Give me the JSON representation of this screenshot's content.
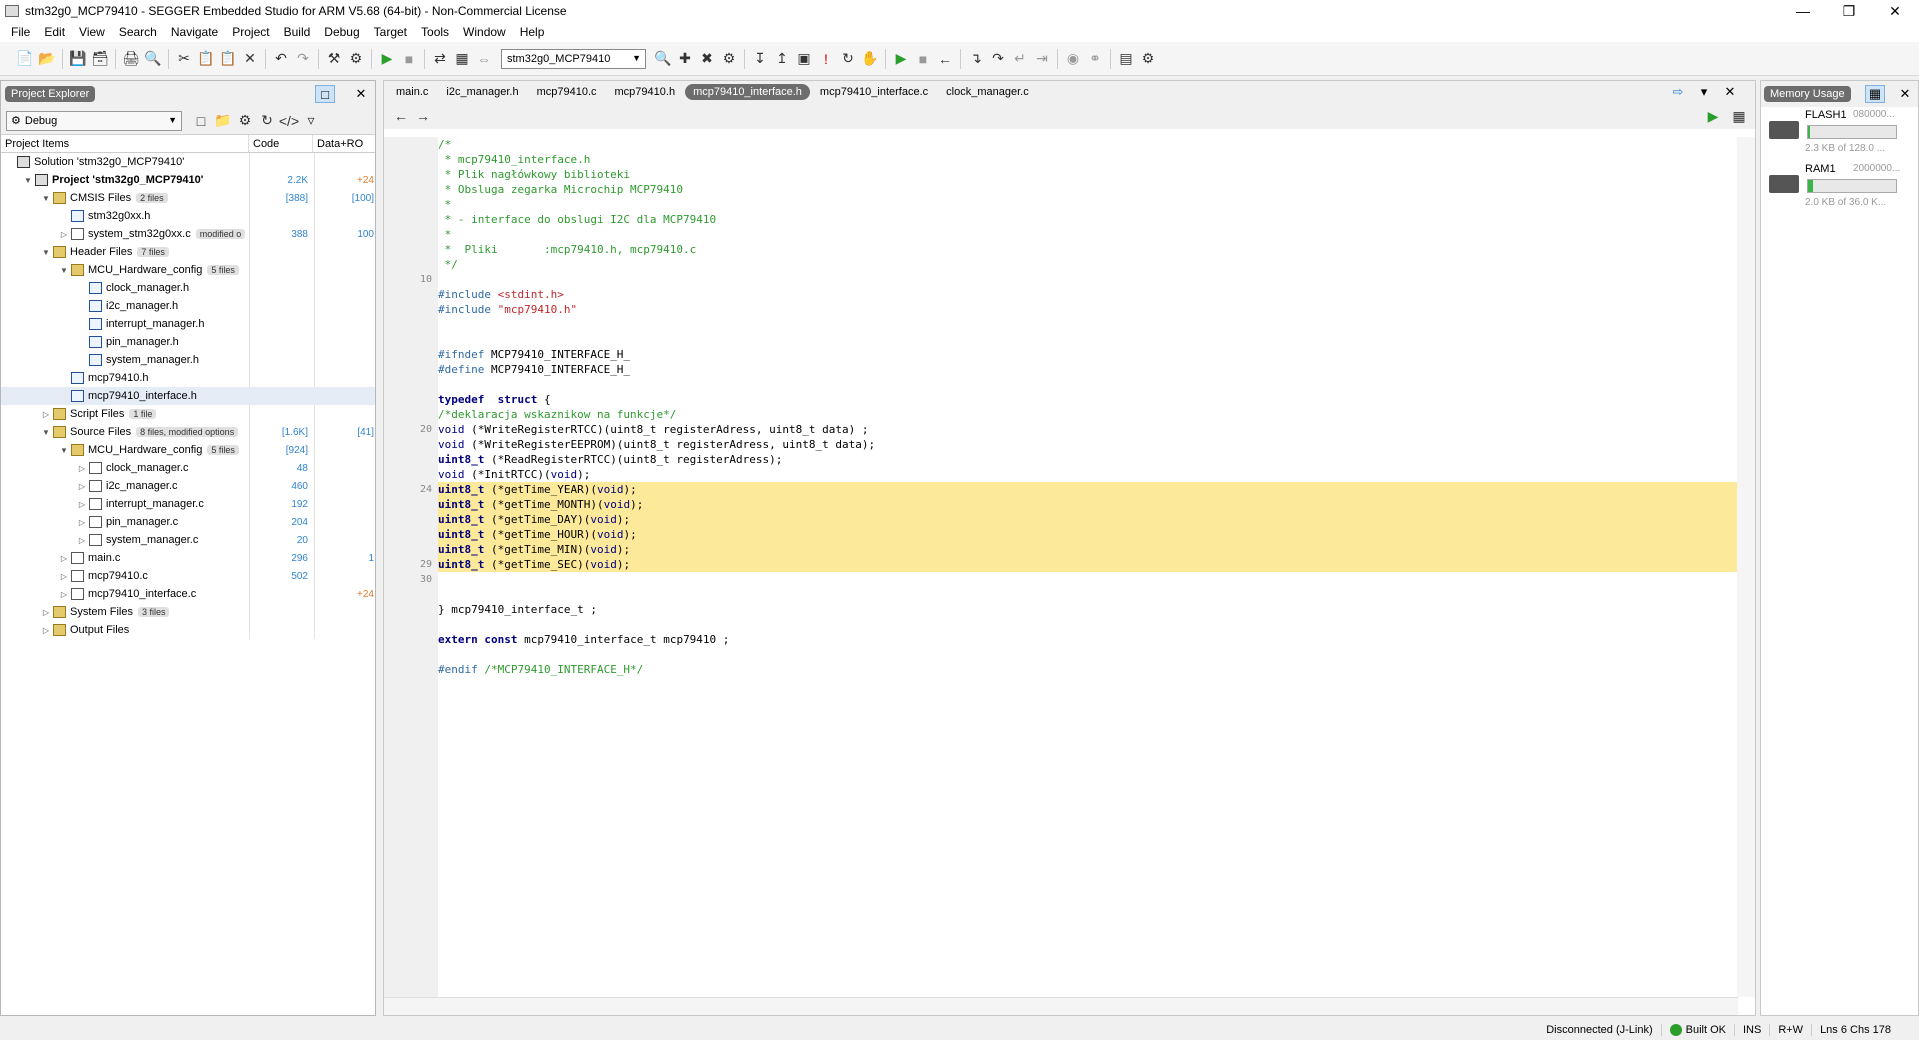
{
  "window": {
    "title": "stm32g0_MCP79410 - SEGGER Embedded Studio for ARM V5.68 (64-bit) - Non-Commercial License"
  },
  "menu": [
    "File",
    "Edit",
    "View",
    "Search",
    "Navigate",
    "Project",
    "Build",
    "Debug",
    "Target",
    "Tools",
    "Window",
    "Help"
  ],
  "toolbar": {
    "project_select": "stm32g0_MCP79410"
  },
  "explorer": {
    "title": "Project Explorer",
    "config": "Debug",
    "columns": {
      "items": "Project Items",
      "code": "Code",
      "data": "Data+RO"
    }
  },
  "tree": [
    {
      "label": "Solution 'stm32g0_MCP79410'",
      "badge": "",
      "code": "",
      "data": ""
    },
    {
      "label": "Project 'stm32g0_MCP79410'",
      "badge": "",
      "code": "2.2K",
      "data": "+24"
    },
    {
      "label": "CMSIS Files",
      "badge": "2 files",
      "code": "[388]",
      "data": "[100]"
    },
    {
      "label": "stm32g0xx.h",
      "badge": "",
      "code": "",
      "data": ""
    },
    {
      "label": "system_stm32g0xx.c",
      "badge": "modified o",
      "code": "388",
      "data": "100"
    },
    {
      "label": "Header Files",
      "badge": "7 files",
      "code": "",
      "data": ""
    },
    {
      "label": "MCU_Hardware_config",
      "badge": "5 files",
      "code": "",
      "data": ""
    },
    {
      "label": "clock_manager.h",
      "badge": "",
      "code": "",
      "data": ""
    },
    {
      "label": "i2c_manager.h",
      "badge": "",
      "code": "",
      "data": ""
    },
    {
      "label": "interrupt_manager.h",
      "badge": "",
      "code": "",
      "data": ""
    },
    {
      "label": "pin_manager.h",
      "badge": "",
      "code": "",
      "data": ""
    },
    {
      "label": "system_manager.h",
      "badge": "",
      "code": "",
      "data": ""
    },
    {
      "label": "mcp79410.h",
      "badge": "",
      "code": "",
      "data": ""
    },
    {
      "label": "mcp79410_interface.h",
      "badge": "",
      "code": "",
      "data": ""
    },
    {
      "label": "Script Files",
      "badge": "1 file",
      "code": "",
      "data": ""
    },
    {
      "label": "Source Files",
      "badge": "8 files, modified options",
      "code": "[1.6K]",
      "data": "[41]"
    },
    {
      "label": "MCU_Hardware_config",
      "badge": "5 files",
      "code": "[924]",
      "data": ""
    },
    {
      "label": "clock_manager.c",
      "badge": "",
      "code": "48",
      "data": ""
    },
    {
      "label": "i2c_manager.c",
      "badge": "",
      "code": "460",
      "data": ""
    },
    {
      "label": "interrupt_manager.c",
      "badge": "",
      "code": "192",
      "data": ""
    },
    {
      "label": "pin_manager.c",
      "badge": "",
      "code": "204",
      "data": ""
    },
    {
      "label": "system_manager.c",
      "badge": "",
      "code": "20",
      "data": ""
    },
    {
      "label": "main.c",
      "badge": "",
      "code": "296",
      "data": "1"
    },
    {
      "label": "mcp79410.c",
      "badge": "",
      "code": "502",
      "data": ""
    },
    {
      "label": "mcp79410_interface.c",
      "badge": "",
      "code": "",
      "data": "+24"
    },
    {
      "label": "System Files",
      "badge": "3 files",
      "code": "",
      "data": ""
    },
    {
      "label": "Output Files",
      "badge": "",
      "code": "",
      "data": ""
    }
  ],
  "tabs": [
    "main.c",
    "i2c_manager.h",
    "mcp79410.c",
    "mcp79410.h",
    "mcp79410_interface.h",
    "mcp79410_interface.c",
    "clock_manager.c"
  ],
  "code": [
    {
      "n": "",
      "t": "/*"
    },
    {
      "n": "",
      "t": " * mcp79410_interface.h"
    },
    {
      "n": "",
      "t": " * Plik nagłówkowy biblioteki"
    },
    {
      "n": "",
      "t": " * Obsluga zegarka Microchip MCP79410"
    },
    {
      "n": "",
      "t": " *"
    },
    {
      "n": "",
      "t": " * - interface do obslugi I2C dla MCP79410"
    },
    {
      "n": "",
      "t": " *"
    },
    {
      "n": "",
      "t": " *  Pliki       :mcp79410.h, mcp79410.c"
    },
    {
      "n": "",
      "t": " */"
    },
    {
      "n": "10",
      "t": ""
    },
    {
      "n": "",
      "t": "#include <stdint.h>"
    },
    {
      "n": "",
      "t": "#include \"mcp79410.h\""
    },
    {
      "n": "",
      "t": ""
    },
    {
      "n": "",
      "t": ""
    },
    {
      "n": "",
      "t": "#ifndef MCP79410_INTERFACE_H_"
    },
    {
      "n": "",
      "t": "#define MCP79410_INTERFACE_H_"
    },
    {
      "n": "",
      "t": ""
    },
    {
      "n": "",
      "t": "typedef  struct {"
    },
    {
      "n": "",
      "t": "/*deklaracja wskaznikow na funkcje*/"
    },
    {
      "n": "20",
      "t": "void (*WriteRegisterRTCC)(uint8_t registerAdress, uint8_t data) ;"
    },
    {
      "n": "",
      "t": "void (*WriteRegisterEEPROM)(uint8_t registerAdress, uint8_t data);"
    },
    {
      "n": "",
      "t": "uint8_t (*ReadRegisterRTCC)(uint8_t registerAdress);"
    },
    {
      "n": "",
      "t": "void (*InitRTCC)(void);"
    },
    {
      "n": "24",
      "t": "uint8_t (*getTime_YEAR)(void);"
    },
    {
      "n": "",
      "t": "uint8_t (*getTime_MONTH)(void);"
    },
    {
      "n": "",
      "t": "uint8_t (*getTime_DAY)(void);"
    },
    {
      "n": "",
      "t": "uint8_t (*getTime_HOUR)(void);"
    },
    {
      "n": "",
      "t": "uint8_t (*getTime_MIN)(void);"
    },
    {
      "n": "29",
      "t": "uint8_t (*getTime_SEC)(void);"
    },
    {
      "n": "30",
      "t": ""
    },
    {
      "n": "",
      "t": ""
    },
    {
      "n": "",
      "t": "} mcp79410_interface_t ;"
    },
    {
      "n": "",
      "t": ""
    },
    {
      "n": "",
      "t": "extern const mcp79410_interface_t mcp79410 ;"
    },
    {
      "n": "",
      "t": ""
    },
    {
      "n": "",
      "t": "#endif /*MCP79410_INTERFACE_H*/"
    }
  ],
  "memory": {
    "title": "Memory Usage",
    "flash": {
      "name": "FLASH1",
      "addr": "080000...",
      "info": "2.3 KB of 128.0 ...",
      "fraction": 0.018
    },
    "ram": {
      "name": "RAM1",
      "addr": "2000000...",
      "info": "2.0 KB of 36.0 K...",
      "fraction": 0.056
    }
  },
  "status": {
    "conn": "Disconnected (J-Link)",
    "build": "Built OK",
    "ins": "INS",
    "rw": "R+W",
    "pos": "Lns 6 Chs 178"
  }
}
